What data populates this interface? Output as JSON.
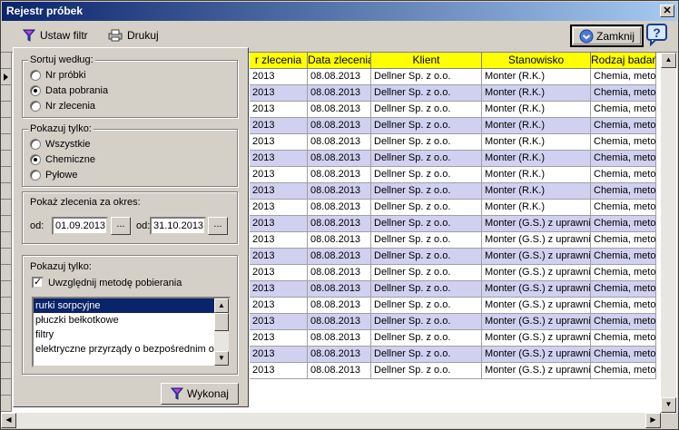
{
  "window": {
    "title": "Rejestr próbek",
    "close_glyph": "✕"
  },
  "toolbar": {
    "filter_label": "Ustaw filtr",
    "print_label": "Drukuj",
    "close_label": "Zamknij"
  },
  "grid": {
    "columns": [
      "r zlecenia",
      "Data zlecenia",
      "Klient",
      "Stanowisko",
      "Rodzaj badań"
    ],
    "rows": [
      [
        "2013",
        "08.08.2013",
        "Dellner Sp. z o.o.",
        "Monter (R.K.)",
        "Chemia, metod"
      ],
      [
        "2013",
        "08.08.2013",
        "Dellner Sp. z o.o.",
        "Monter (R.K.)",
        "Chemia, metod"
      ],
      [
        "2013",
        "08.08.2013",
        "Dellner Sp. z o.o.",
        "Monter (R.K.)",
        "Chemia, metod"
      ],
      [
        "2013",
        "08.08.2013",
        "Dellner Sp. z o.o.",
        "Monter (R.K.)",
        "Chemia, metod"
      ],
      [
        "2013",
        "08.08.2013",
        "Dellner Sp. z o.o.",
        "Monter (R.K.)",
        "Chemia, metod"
      ],
      [
        "2013",
        "08.08.2013",
        "Dellner Sp. z o.o.",
        "Monter (R.K.)",
        "Chemia, metod"
      ],
      [
        "2013",
        "08.08.2013",
        "Dellner Sp. z o.o.",
        "Monter (R.K.)",
        "Chemia, metod"
      ],
      [
        "2013",
        "08.08.2013",
        "Dellner Sp. z o.o.",
        "Monter (R.K.)",
        "Chemia, metod"
      ],
      [
        "2013",
        "08.08.2013",
        "Dellner Sp. z o.o.",
        "Monter (R.K.)",
        "Chemia, metod"
      ],
      [
        "2013",
        "08.08.2013",
        "Dellner Sp. z o.o.",
        "Monter (G.S.) z uprawnie",
        "Chemia, metod"
      ],
      [
        "2013",
        "08.08.2013",
        "Dellner Sp. z o.o.",
        "Monter (G.S.) z uprawnie",
        "Chemia, metod"
      ],
      [
        "2013",
        "08.08.2013",
        "Dellner Sp. z o.o.",
        "Monter (G.S.) z uprawnie",
        "Chemia, metod"
      ],
      [
        "2013",
        "08.08.2013",
        "Dellner Sp. z o.o.",
        "Monter (G.S.) z uprawnie",
        "Chemia, metod"
      ],
      [
        "2013",
        "08.08.2013",
        "Dellner Sp. z o.o.",
        "Monter (G.S.) z uprawnie",
        "Chemia, metod"
      ],
      [
        "2013",
        "08.08.2013",
        "Dellner Sp. z o.o.",
        "Monter (G.S.) z uprawnie",
        "Chemia, metod"
      ],
      [
        "2013",
        "08.08.2013",
        "Dellner Sp. z o.o.",
        "Monter (G.S.) z uprawnie",
        "Chemia, metod"
      ],
      [
        "2013",
        "08.08.2013",
        "Dellner Sp. z o.o.",
        "Monter (G.S.) z uprawnie",
        "Chemia, metod"
      ],
      [
        "2013",
        "08.08.2013",
        "Dellner Sp. z o.o.",
        "Monter (G.S.) z uprawnie",
        "Chemia, metod"
      ],
      [
        "2013",
        "08.08.2013",
        "Dellner Sp. z o.o.",
        "Monter (G.S.) z uprawnie",
        "Chemia, metod"
      ]
    ],
    "row_colors": [
      "#ffffff",
      "#d0d0f0"
    ],
    "header_color": "#ffff00"
  },
  "panel": {
    "sort": {
      "label": "Sortuj według:",
      "options": [
        "Nr próbki",
        "Data pobrania",
        "Nr zlecenia"
      ],
      "selected": 1
    },
    "show": {
      "label": "Pokazuj tylko:",
      "options": [
        "Wszystkie",
        "Chemiczne",
        "Pyłowe"
      ],
      "selected": 1
    },
    "period": {
      "label": "Pokaż zlecenia za okres:",
      "from_label": "od:",
      "from_value": "01.09.2013",
      "to_label": "od:",
      "to_value": "31.10.2013",
      "button_label": "..."
    },
    "method": {
      "label": "Pokazuj tylko:",
      "checkbox_label": "Uwzględnij metodę pobierania",
      "checked": true,
      "items": [
        "rurki sorpcyjne",
        "płuczki bełkotkowe",
        "filtry",
        "elektryczne przyrządy o bezpośrednim odc"
      ],
      "selected": 0
    },
    "execute_label": "Wykonaj"
  }
}
